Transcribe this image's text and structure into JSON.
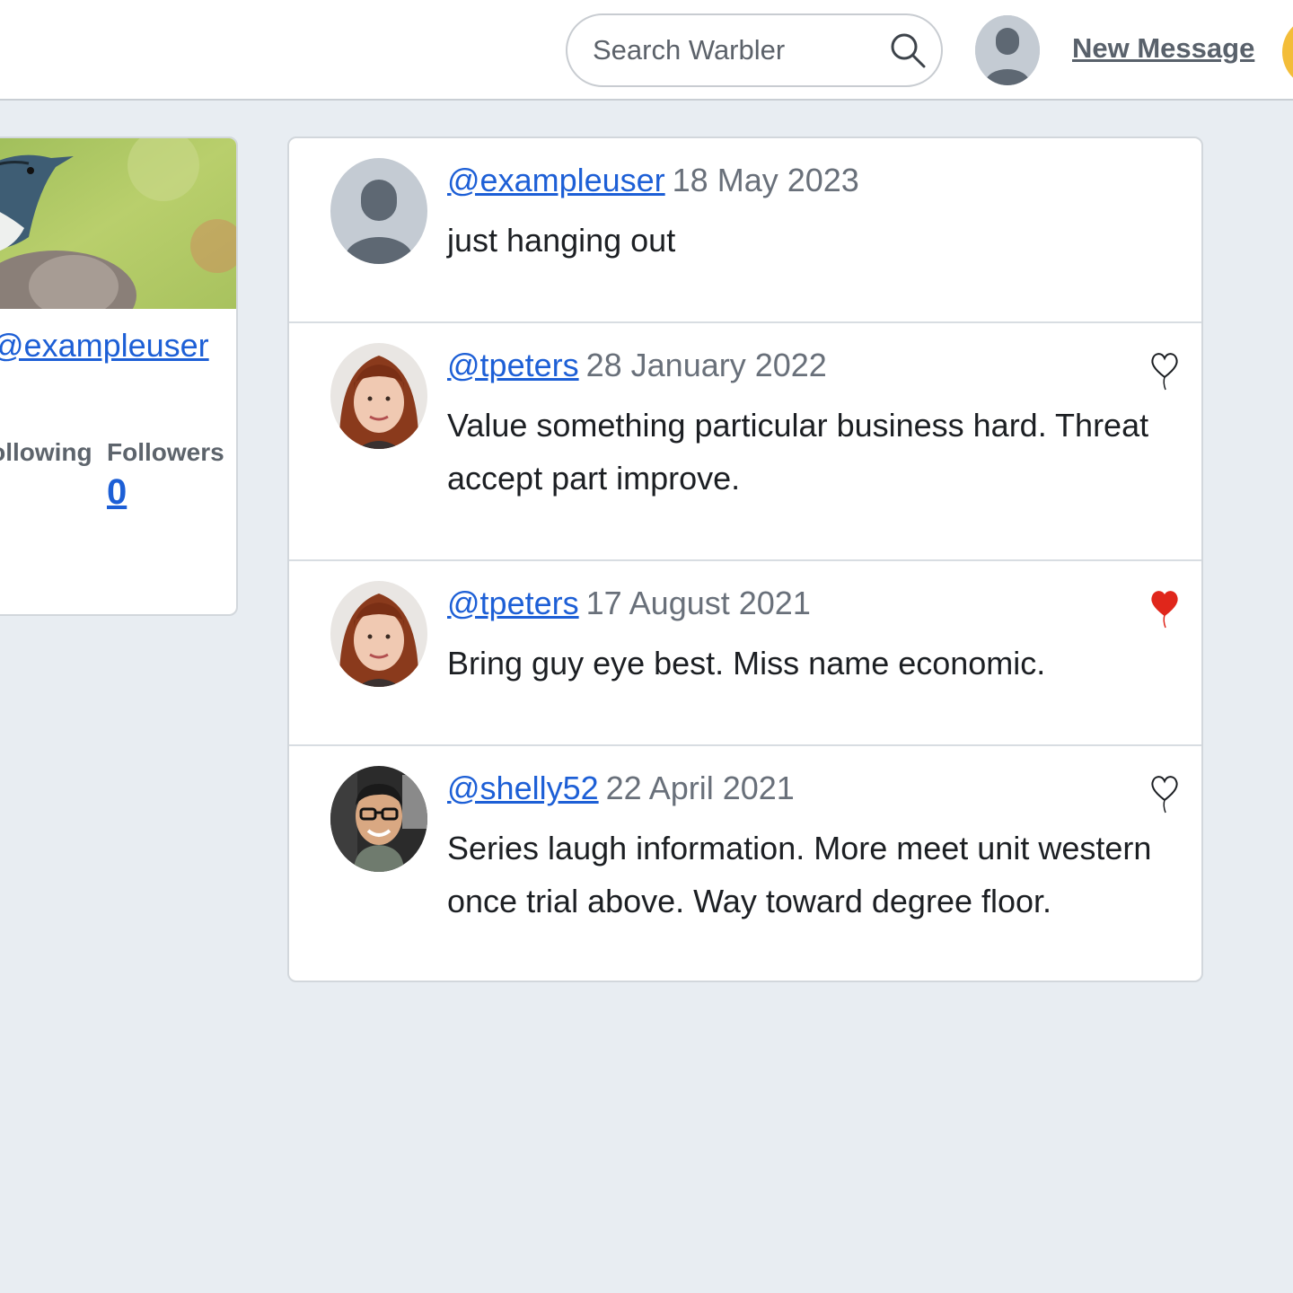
{
  "nav": {
    "search_placeholder": "Search Warbler",
    "new_message_label": "New Message",
    "icons": {
      "search": "search-icon",
      "avatar": "default-avatar-icon"
    },
    "badge_color": "#f3bd39"
  },
  "profile": {
    "username": "@exampleuser",
    "following_label": "Following",
    "followers_label": "Followers",
    "followers_count": "0"
  },
  "messages": [
    {
      "username": "@exampleuser",
      "date": "18 May 2023",
      "text": "just hanging out",
      "avatar": "default-avatar",
      "liked": null
    },
    {
      "username": "@tpeters",
      "date": "28 January 2022",
      "text": "Value something particular business hard. Threat accept part improve.",
      "avatar": "woman-red-hair-photo",
      "liked": false
    },
    {
      "username": "@tpeters",
      "date": "17 August 2021",
      "text": "Bring guy eye best. Miss name economic.",
      "avatar": "woman-red-hair-photo",
      "liked": true
    },
    {
      "username": "@shelly52",
      "date": "22 April 2021",
      "text": "Series laugh information. More meet unit western once trial above. Way toward degree floor.",
      "avatar": "man-glasses-photo",
      "liked": false
    }
  ],
  "colors": {
    "link": "#1d5fd6",
    "liked_heart": "#e0261b",
    "page_bg": "#e8edf2"
  }
}
